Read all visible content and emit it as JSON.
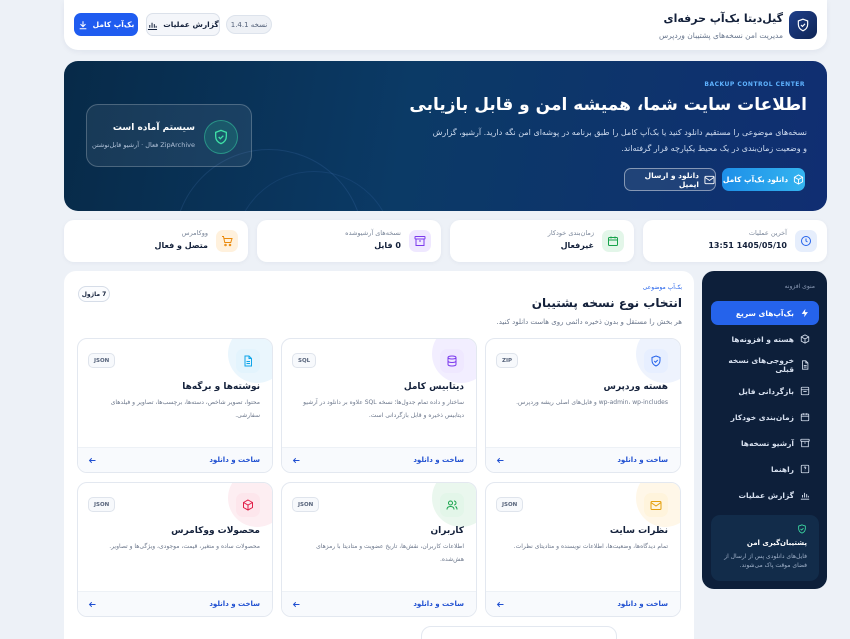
{
  "header": {
    "title": "گیل‌دیتا بک‌آپ حرفه‌ای",
    "subtitle": "مدیریت امن نسخه‌های پشتیبان وردپرس",
    "full_backup_label": "بک‌آپ کامل",
    "report_label": "گزارش عملیات",
    "version_label": "نسخه 1.4.1"
  },
  "hero": {
    "eyebrow": "BACKUP CONTROL CENTER",
    "title": "اطلاعات سایت شما، همیشه امن و قابل بازیابی",
    "description": "نسخه‌های موضوعی را مستقیم دانلود کنید یا بک‌آپ کامل را طبق برنامه در پوشه‌ای امن نگه دارید. آرشیو، گزارش و وضعیت زمان‌بندی در یک محیط یکپارچه قرار گرفته‌اند.",
    "download_full_label": "دانلود بک‌آپ کامل",
    "download_email_label": "دانلود و ارسال ایمیل",
    "status_title": "سیستم آماده است",
    "status_sub": "ZipArchive فعال · آرشیو قابل‌نوشتن"
  },
  "stats": [
    {
      "label": "آخرین عملیات",
      "value": "1405/05/10 13:51",
      "icon": "clock-icon",
      "color": "#2563eb"
    },
    {
      "label": "زمان‌بندی خودکار",
      "value": "غیرفعال",
      "icon": "calendar-icon",
      "color": "#16a34a"
    },
    {
      "label": "نسخه‌های آرشیوشده",
      "value": "0 فایل",
      "icon": "archive-icon",
      "color": "#7c3aed"
    },
    {
      "label": "ووکامرس",
      "value": "متصل و فعال",
      "icon": "cart-icon",
      "color": "#ea8a0c"
    }
  ],
  "sidebar": {
    "title": "منوی افزونه",
    "items": [
      {
        "label": "بک‌آپ‌های سریع",
        "icon": "lightning-icon"
      },
      {
        "label": "هسته و افزونه‌ها",
        "icon": "cube-icon"
      },
      {
        "label": "خروجی‌های نسخه قبلی",
        "icon": "file-icon"
      },
      {
        "label": "بازگردانی فایل",
        "icon": "restore-icon"
      },
      {
        "label": "زمان‌بندی خودکار",
        "icon": "calendar-icon"
      },
      {
        "label": "آرشیو نسخه‌ها",
        "icon": "archive-icon"
      },
      {
        "label": "راهنما",
        "icon": "help-icon"
      },
      {
        "label": "گزارش عملیات",
        "icon": "chart-icon"
      }
    ],
    "box_title": "پشتیبان‌گیری امن",
    "box_desc": "فایل‌های دانلودی پس از ارسال از فضای موقت پاک می‌شوند."
  },
  "main": {
    "eyebrow": "بک‌آپ موضوعی",
    "title": "انتخاب نوع نسخه پشتیبان",
    "subtitle": "هر بخش را مستقل و بدون ذخیره دائمی روی هاست دانلود کنید.",
    "modules_badge": "7 ماژول",
    "cards": [
      {
        "title": "هسته وردپرس",
        "desc": "wp-admin، wp-includes و فایل‌های اصلی ریشه وردپرس.",
        "tag": "ZIP",
        "icon": "shield-icon",
        "color": "#2563eb",
        "bg": "#e7efff",
        "action": "ساخت و دانلود"
      },
      {
        "title": "دیتابیس کامل",
        "desc": "ساختار و داده تمام جدول‌ها؛ نسخه SQL علاوه بر دانلود در آرشیو دیتابیس ذخیره و قابل بازگردانی است.",
        "tag": "SQL",
        "icon": "database-icon",
        "color": "#7c3aed",
        "bg": "#efe8ff",
        "action": "ساخت و دانلود"
      },
      {
        "title": "نوشته‌ها و برگه‌ها",
        "desc": "محتوا، تصویر شاخص، دسته‌ها، برچسب‌ها، تصاویر و فیلدهای سفارشی.",
        "tag": "JSON",
        "icon": "document-icon",
        "color": "#0ea5e9",
        "bg": "#e3f4fd",
        "action": "ساخت و دانلود"
      },
      {
        "title": "نظرات سایت",
        "desc": "تمام دیدگاه‌ها، وضعیت‌ها، اطلاعات نویسنده و متادیتای نظرات.",
        "tag": "JSON",
        "icon": "mail-icon",
        "color": "#e5a00d",
        "bg": "#fff4dc",
        "action": "ساخت و دانلود"
      },
      {
        "title": "کاربران",
        "desc": "اطلاعات کاربران، نقش‌ها، تاریخ عضویت و متادیتا با رمزهای هش‌شده.",
        "tag": "JSON",
        "icon": "users-icon",
        "color": "#16a34a",
        "bg": "#e3f6e9",
        "action": "ساخت و دانلود"
      },
      {
        "title": "محصولات ووکامرس",
        "desc": "محصولات ساده و متغیر، قیمت، موجودی، ویژگی‌ها و تصاویر.",
        "tag": "JSON",
        "icon": "box-icon",
        "color": "#e11d48",
        "bg": "#fde6ec",
        "action": "ساخت و دانلود"
      }
    ]
  },
  "colors": {
    "accent": "#2563eb",
    "hero_dark": "#072a48",
    "sidebar": "#0d1f3a",
    "success": "#22c08a"
  }
}
